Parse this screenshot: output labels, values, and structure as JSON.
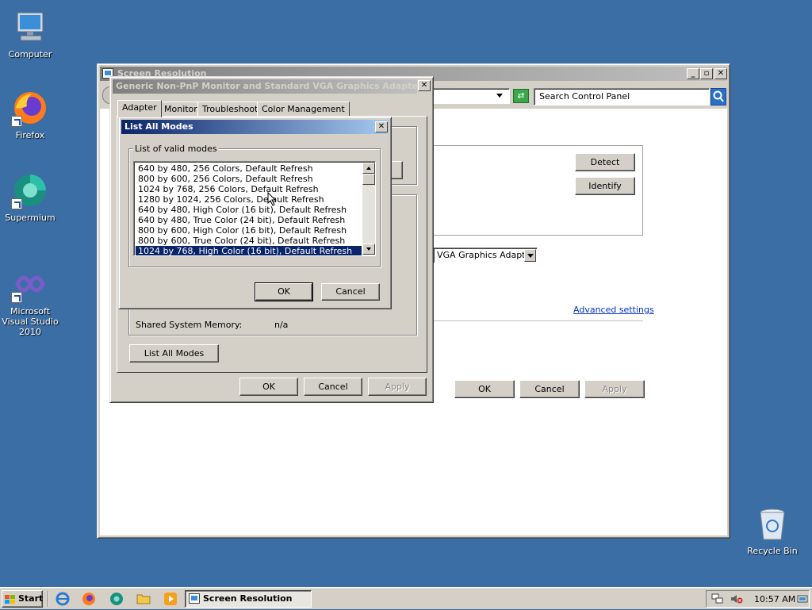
{
  "desktop": {
    "icons": [
      {
        "label": "Computer"
      },
      {
        "label": "Firefox"
      },
      {
        "label": "Supermium"
      },
      {
        "label": "Microsoft Visual Studio 2010"
      },
      {
        "label": "Recycle Bin"
      }
    ]
  },
  "main_window": {
    "title": "Screen Resolution",
    "search_placeholder": "Search Control Panel",
    "detect_label": "Detect",
    "identify_label": "Identify",
    "display_dropdown_value": "VGA Graphics Adapter",
    "advanced_settings_link": "Advanced settings",
    "ok_label": "OK",
    "cancel_label": "Cancel",
    "apply_label": "Apply"
  },
  "adapter_dialog": {
    "title": "Generic Non-PnP Monitor and Standard VGA Graphics Adapter Pro...",
    "tabs": [
      {
        "label": "Adapter"
      },
      {
        "label": "Monitor"
      },
      {
        "label": "Troubleshoot"
      },
      {
        "label": "Color Management"
      }
    ],
    "shared_memory_label": "Shared System Memory:",
    "shared_memory_value": "n/a",
    "list_all_modes_label": "List All Modes",
    "ok_label": "OK",
    "cancel_label": "Cancel",
    "apply_label": "Apply"
  },
  "modes_dialog": {
    "title": "List All Modes",
    "group_label": "List of valid modes",
    "modes": [
      "640 by 480, 256 Colors, Default Refresh",
      "800 by 600, 256 Colors, Default Refresh",
      "1024 by 768, 256 Colors, Default Refresh",
      "1280 by 1024, 256 Colors, Default Refresh",
      "640 by 480, High Color (16 bit), Default Refresh",
      "640 by 480, True Color (24 bit), Default Refresh",
      "800 by 600, High Color (16 bit), Default Refresh",
      "800 by 600, True Color (24 bit), Default Refresh",
      "1024 by 768, High Color (16 bit), Default Refresh"
    ],
    "selected_index": 8,
    "ok_label": "OK",
    "cancel_label": "Cancel"
  },
  "taskbar": {
    "start_label": "Start",
    "task_label": "Screen Resolution",
    "clock": "10:57 AM"
  },
  "colors": {
    "desktop": "#3a6ea5",
    "selection": "#0a246a",
    "link": "#0033cc"
  }
}
